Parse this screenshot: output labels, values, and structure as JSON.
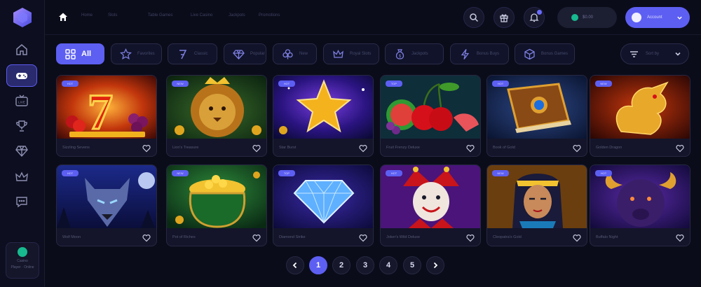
{
  "colors": {
    "accent": "#5d5ff2",
    "background": "#0b0c1a",
    "card": "#14152a",
    "balance_coin": "#17b98e"
  },
  "sidebar": {
    "logo": "cube-logo-icon",
    "items": [
      {
        "icon": "home-icon",
        "active": false
      },
      {
        "icon": "gamepad-icon",
        "active": true
      },
      {
        "icon": "live-tv-icon",
        "active": false
      },
      {
        "icon": "trophy-icon",
        "active": false
      },
      {
        "icon": "diamond-icon",
        "active": false
      },
      {
        "icon": "crown-icon",
        "active": false
      },
      {
        "icon": "chat-icon",
        "active": false
      }
    ],
    "user": {
      "line1": "Casino",
      "line2": "Player · Online"
    }
  },
  "topbar": {
    "nav": [
      "Home",
      "Slots",
      "Table Games",
      "Live Casino",
      "Jackpots",
      "Promotions"
    ],
    "actions": [
      "search-icon",
      "gift-icon",
      "bell-icon"
    ],
    "balance": "$0.00",
    "profile": "Account"
  },
  "filters": {
    "items": [
      {
        "label": "All",
        "icon": "grid-icon",
        "active": true
      },
      {
        "label": "Favorites",
        "icon": "star-icon",
        "active": false
      },
      {
        "label": "Classic",
        "icon": "seven-icon",
        "active": false
      },
      {
        "label": "Popular",
        "icon": "diamond-icon",
        "active": false
      },
      {
        "label": "New",
        "icon": "clover-icon",
        "active": false
      },
      {
        "label": "Royal Slots",
        "icon": "crown-icon",
        "active": false
      },
      {
        "label": "Jackpots",
        "icon": "money-bag-icon",
        "active": false
      },
      {
        "label": "Bonus Buys",
        "icon": "lightning-icon",
        "active": false
      },
      {
        "label": "Bonus Games",
        "icon": "cube-icon",
        "active": false
      }
    ],
    "sort_label": "Sort by"
  },
  "games": [
    {
      "name": "Sizzling Sevens",
      "badge": "HOT",
      "theme": "sevens"
    },
    {
      "name": "Lion's Treasure",
      "badge": "NEW",
      "theme": "lion"
    },
    {
      "name": "Star Burst",
      "badge": "HOT",
      "theme": "star"
    },
    {
      "name": "Fruit Frenzy Deluxe",
      "badge": "TOP",
      "theme": "fruits"
    },
    {
      "name": "Book of Gold",
      "badge": "HOT",
      "theme": "book"
    },
    {
      "name": "Golden Dragon",
      "badge": "NEW",
      "theme": "dragon"
    },
    {
      "name": "Wolf Moon",
      "badge": "HOT",
      "theme": "wolf"
    },
    {
      "name": "Pot of Riches",
      "badge": "NEW",
      "theme": "pot"
    },
    {
      "name": "Diamond Strike",
      "badge": "TOP",
      "theme": "diamond"
    },
    {
      "name": "Joker's Wild Deluxe",
      "badge": "HOT",
      "theme": "joker"
    },
    {
      "name": "Cleopatra's Gold",
      "badge": "NEW",
      "theme": "cleopatra"
    },
    {
      "name": "Buffalo Night",
      "badge": "HOT",
      "theme": "buffalo"
    }
  ],
  "pagination": {
    "pages": [
      "1",
      "2",
      "3",
      "4",
      "5"
    ],
    "current": "1"
  }
}
